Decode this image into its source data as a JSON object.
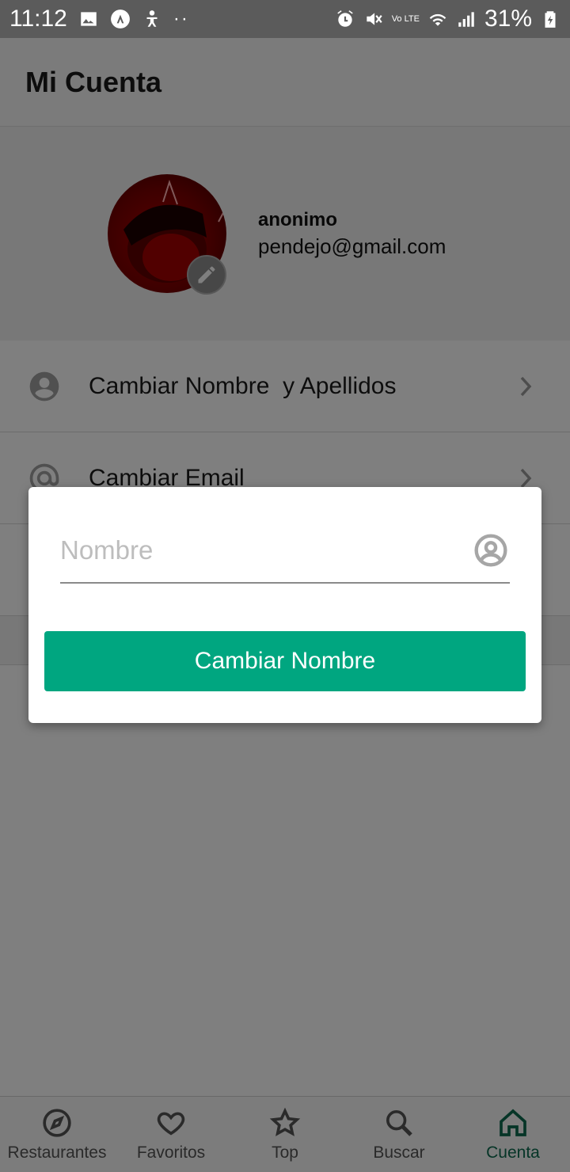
{
  "status_bar": {
    "time": "11:12",
    "battery": "31%",
    "dots": "··",
    "network": "Vo LTE"
  },
  "header": {
    "title": "Mi Cuenta"
  },
  "profile": {
    "name": "anonimo",
    "email": "pendejo@gmail.com"
  },
  "options": [
    {
      "label": "Cambiar Nombre  y Apellidos",
      "icon": "account-circle-icon"
    },
    {
      "label": "Cambiar Email",
      "icon": "at-icon"
    }
  ],
  "modal": {
    "input_placeholder": "Nombre",
    "input_value": "",
    "button_label": "Cambiar Nombre"
  },
  "bottom_nav": {
    "items": [
      {
        "label": "Restaurantes",
        "icon": "compass-icon",
        "active": false
      },
      {
        "label": "Favoritos",
        "icon": "heart-icon",
        "active": false
      },
      {
        "label": "Top",
        "icon": "star-icon",
        "active": false
      },
      {
        "label": "Buscar",
        "icon": "search-icon",
        "active": false
      },
      {
        "label": "Cuenta",
        "icon": "home-icon",
        "active": true
      }
    ]
  },
  "colors": {
    "accent": "#00a680",
    "nav_active": "#0c6b4f",
    "overlay": "rgba(0,0,0,0.5)"
  }
}
